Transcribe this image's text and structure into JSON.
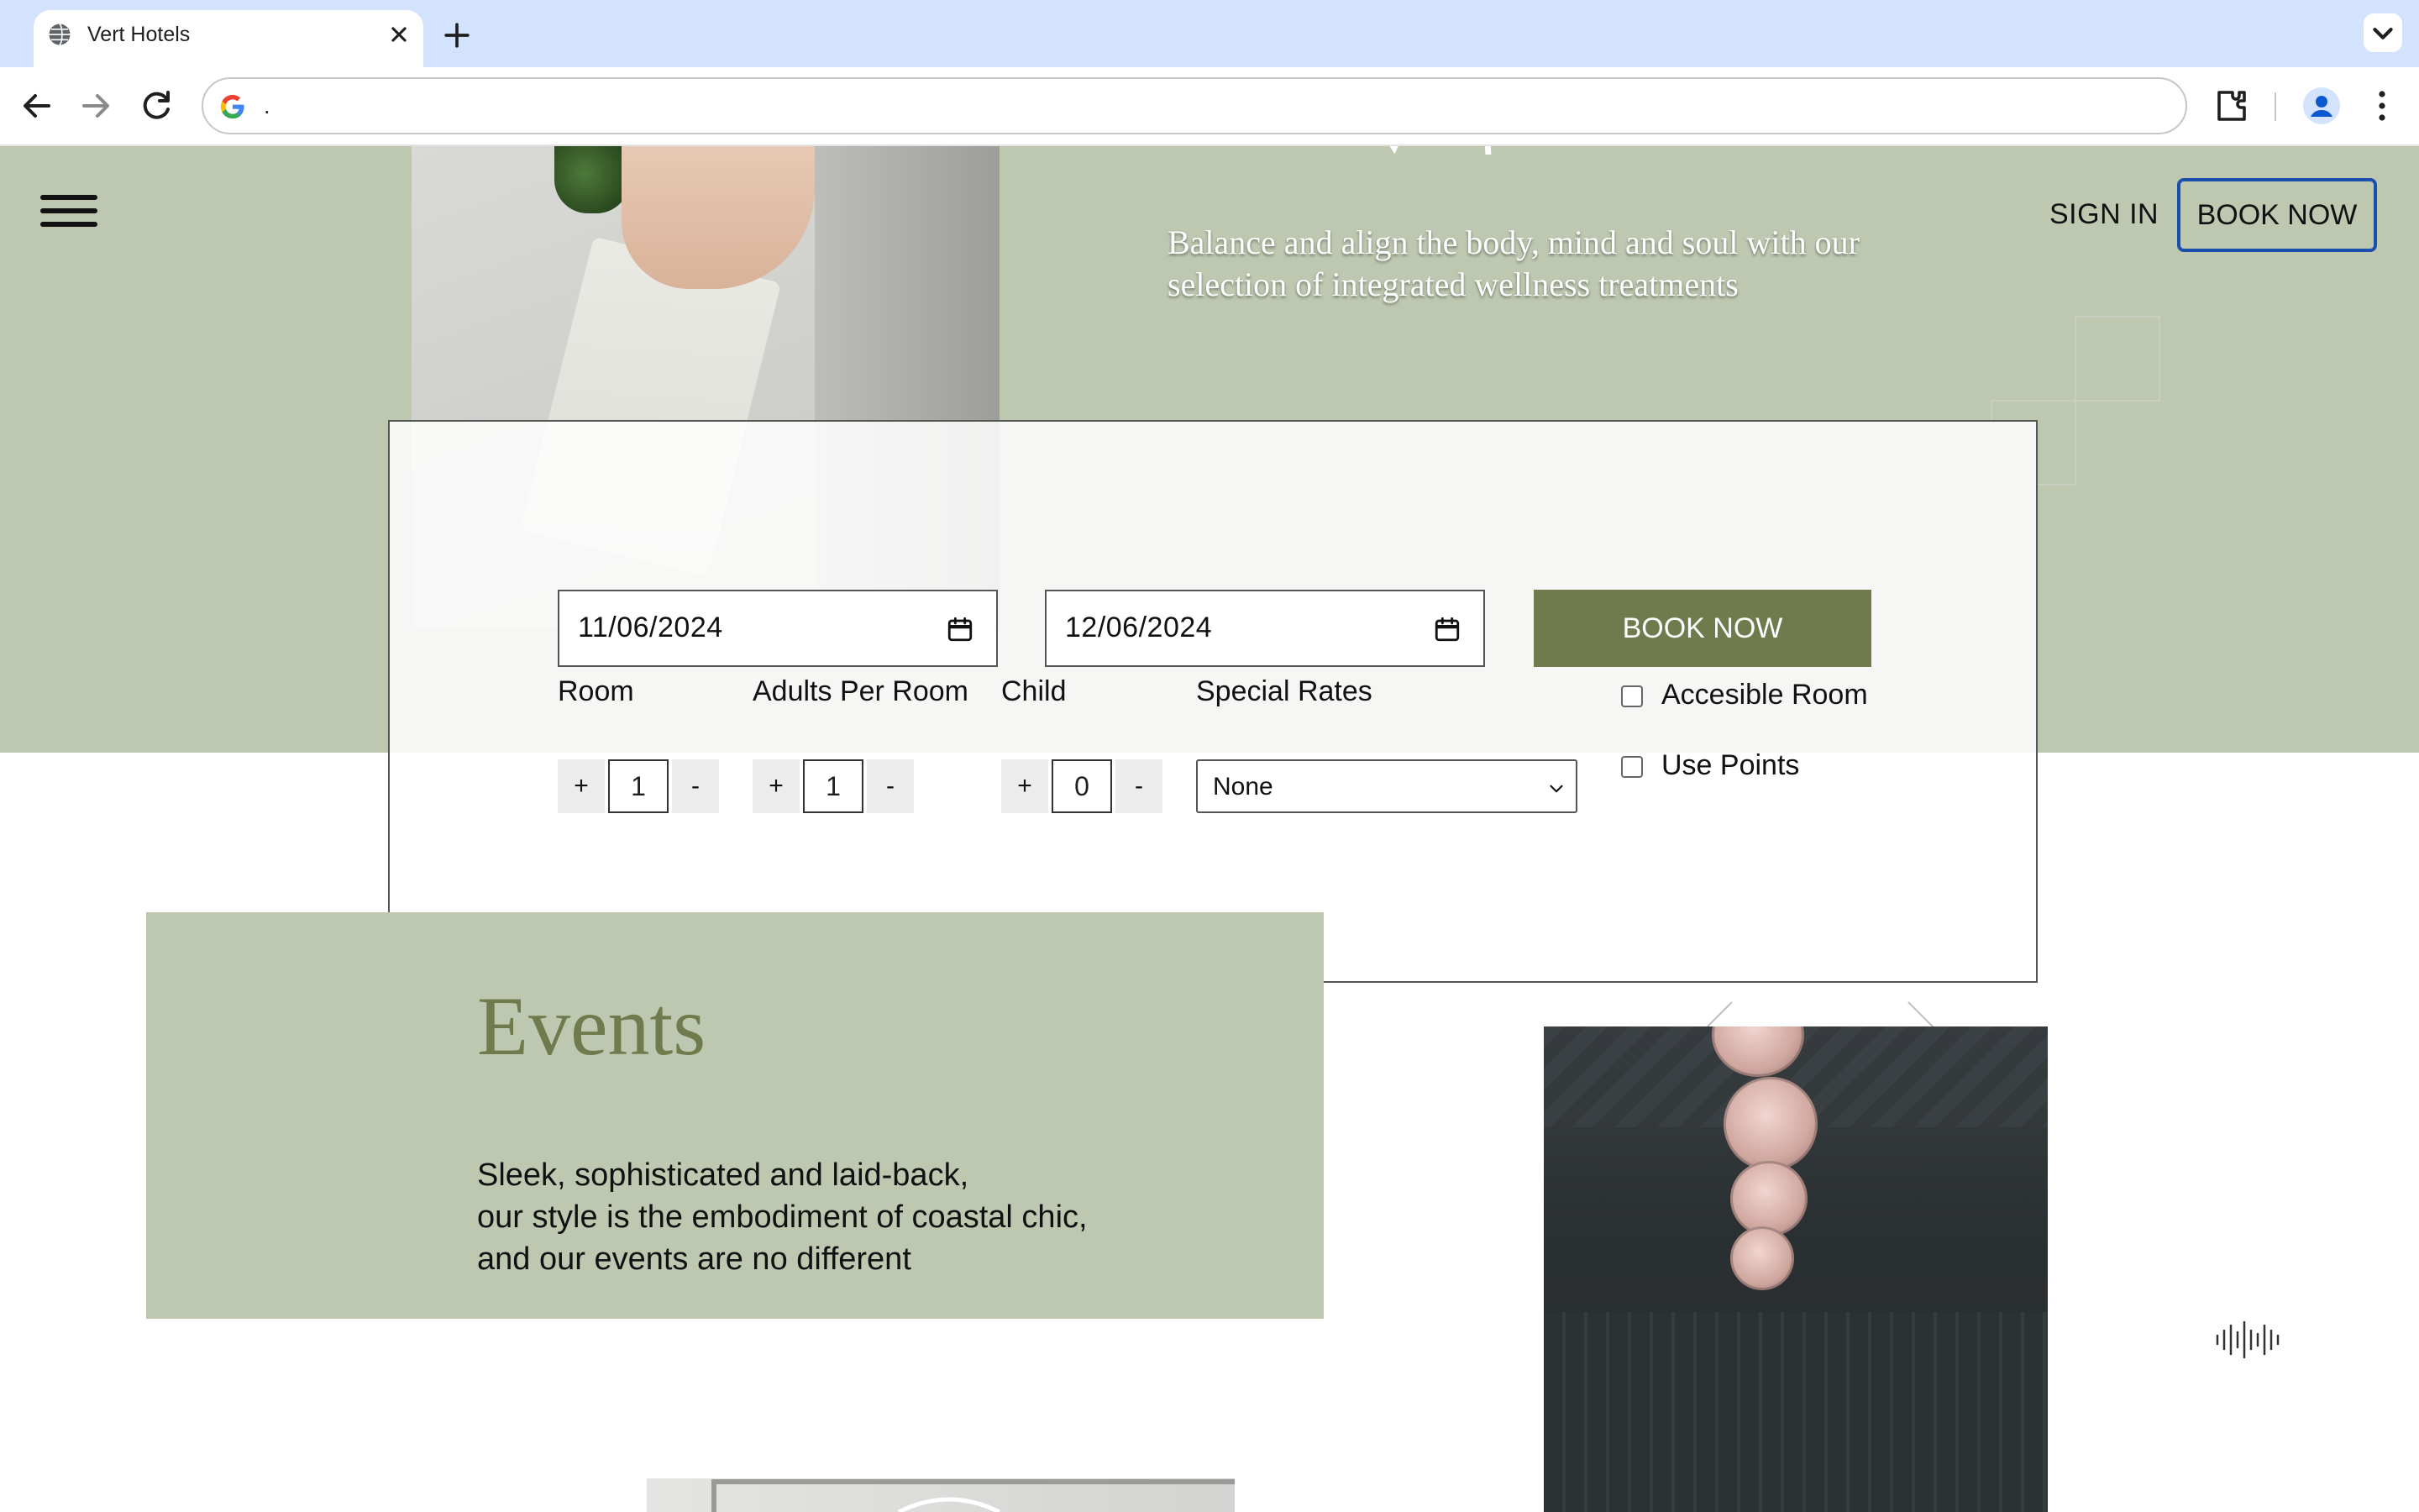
{
  "browser": {
    "tab_title": "Vert Hotels",
    "url": ".",
    "icons": [
      "globe-icon",
      "close-icon",
      "plus-icon",
      "chevron-down-icon",
      "back-icon",
      "forward-icon",
      "reload-icon",
      "google-icon",
      "extensions-icon",
      "profile-icon",
      "more-vert-icon"
    ]
  },
  "header": {
    "sign_in": "SIGN IN",
    "book_now": "BOOK NOW"
  },
  "hero": {
    "text": "Balance and align the body, mind and soul with our selection of integrated wellness treatments"
  },
  "booking": {
    "check_in": "11/06/2024",
    "check_out": "12/06/2024",
    "book_now": "BOOK NOW",
    "room_label": "Room",
    "room_value": "1",
    "adults_label": "Adults Per Room",
    "adults_value": "1",
    "child_label": "Child",
    "child_value": "0",
    "special_rates_label": "Special Rates",
    "special_rates_value": "None",
    "plus": "+",
    "minus": "-",
    "accessible_room": "Accesible Room",
    "accessible_checked": false,
    "use_points": "Use Points",
    "use_points_checked": false
  },
  "events": {
    "title": "Events",
    "desc_lines": [
      "Sleek, sophisticated and laid-back,",
      "our style is the embodiment of coastal chic,",
      "and our events are no different"
    ]
  },
  "colors": {
    "sage": "#bec8b0",
    "olive": "#6f7b4d",
    "focus": "#1b4fad"
  }
}
